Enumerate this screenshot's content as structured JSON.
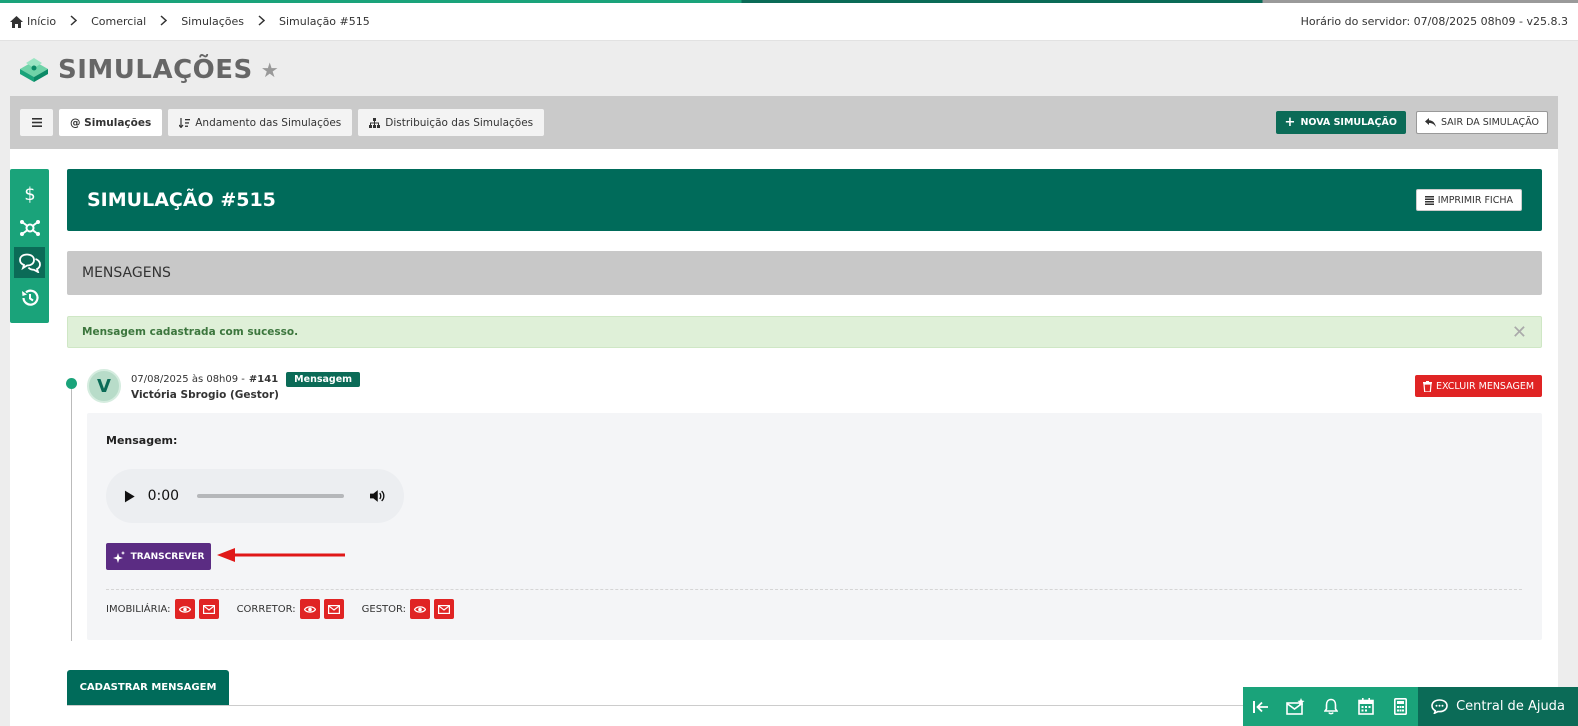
{
  "breadcrumb": {
    "items": [
      "Início",
      "Comercial",
      "Simulações",
      "Simulação #515"
    ]
  },
  "server_time": "Horário do servidor: 07/08/2025 08h09 - v25.8.3",
  "page": {
    "title": "SIMULAÇÕES"
  },
  "tabs": {
    "items": [
      {
        "label": "@ Simulações"
      },
      {
        "label": "Andamento das Simulações"
      },
      {
        "label": "Distribuição das Simulações"
      }
    ],
    "new_label": "NOVA SIMULAÇÃO",
    "exit_label": "SAIR DA SIMULAÇÃO"
  },
  "sidenav": {
    "icons": [
      "dollar-icon",
      "network-icon",
      "chat-icon",
      "history-icon"
    ]
  },
  "simulation": {
    "title": "SIMULAÇÃO #515",
    "print_label": "IMPRIMIR FICHA"
  },
  "section": {
    "title": "MENSAGENS"
  },
  "alert": {
    "text": "Mensagem cadastrada com sucesso."
  },
  "message": {
    "avatar_initial": "V",
    "datetime": "07/08/2025 às 08h09 -",
    "id": "#141",
    "badge": "Mensagem",
    "author": "Victória Sbrogio (Gestor)",
    "delete_label": "EXCLUIR MENSAGEM",
    "body_label": "Mensagem:",
    "audio_time": "0:00",
    "transcribe_label": "TRANSCREVER",
    "permissions": {
      "imobiliaria": "IMOBILIÁRIA:",
      "corretor": "CORRETOR:",
      "gestor": "GESTOR:"
    }
  },
  "form_tab": {
    "label": "CADASTRAR MENSAGEM"
  },
  "help": {
    "label": "Central de Ajuda"
  },
  "colors": {
    "primary": "#006b5a",
    "accent": "#1aa37a",
    "danger": "#e02424",
    "purple": "#5b2c83",
    "success_bg": "#dff0d8"
  }
}
